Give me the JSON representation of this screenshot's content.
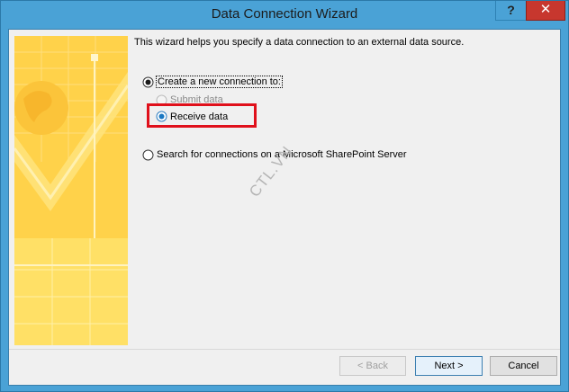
{
  "window": {
    "title": "Data Connection Wizard",
    "help_label": "?",
    "close_label": "✕"
  },
  "intro": "This wizard helps you specify a data connection to an external data source.",
  "options": {
    "create_new": {
      "label": "Create a new connection to:",
      "selected": true
    },
    "submit_data": {
      "label": "Submit data",
      "enabled": false
    },
    "receive_data": {
      "label": "Receive data",
      "selected": true
    },
    "search_sharepoint": {
      "label": "Search for connections on a Microsoft SharePoint Server",
      "selected": false
    }
  },
  "watermark": "CTL.VN",
  "buttons": {
    "back": "< Back",
    "next": "Next >",
    "cancel": "Cancel"
  },
  "colors": {
    "highlight": "#e0101b",
    "banner": "#ffd75a",
    "close": "#c7372e"
  }
}
